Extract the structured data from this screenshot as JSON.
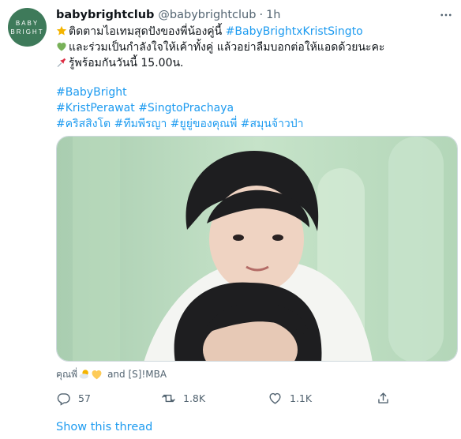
{
  "tweet": {
    "avatar_line1": "BABY",
    "avatar_line2": "BRIGHT",
    "display_name": "babybrightclub",
    "handle": "@babybrightclub",
    "separator": "·",
    "time": "1h",
    "lines": [
      {
        "icon": "star-emoji",
        "plain": "ติดตามไอเทมสุดปังของพี่น้องคู่นี้ ",
        "hashtag": "#BabyBrightxKristSingto"
      },
      {
        "icon": "green-heart-emoji",
        "plain": "และร่วมเป็นกำลังใจให้เค้าทั้งคู่ แล้วอย่าลืมบอกต่อให้แอดด้วยนะคะ"
      },
      {
        "icon": "pushpin-emoji",
        "plain": "รู้พร้อมกันวันนี้ 15.00น."
      }
    ],
    "hashtags": {
      "line1": "#BabyBright",
      "line2a": "#KristPerawat",
      "line2b": "#SingtoPrachaya",
      "line3a": "#คริสสิงโต",
      "line3b": "#ทีมพีรญา",
      "line3c": "#ยูยู่ของคุณพี่",
      "line3d": "#สมุนจ้าวป่า"
    },
    "tagged": {
      "prefix": "คุณพี่",
      "suffix": "and [S]!MBA"
    },
    "actions": {
      "reply_count": "57",
      "retweet_count": "1.8K",
      "like_count": "1.1K"
    },
    "show_thread": "Show this thread"
  },
  "colors": {
    "brand_blue": "#1d9bf0",
    "avatar_green": "#3e7a5a",
    "muted": "#536471",
    "photo_bg": "#b7d9bc"
  },
  "icons": [
    "more-icon",
    "reply-icon",
    "retweet-icon",
    "like-icon",
    "share-icon"
  ]
}
